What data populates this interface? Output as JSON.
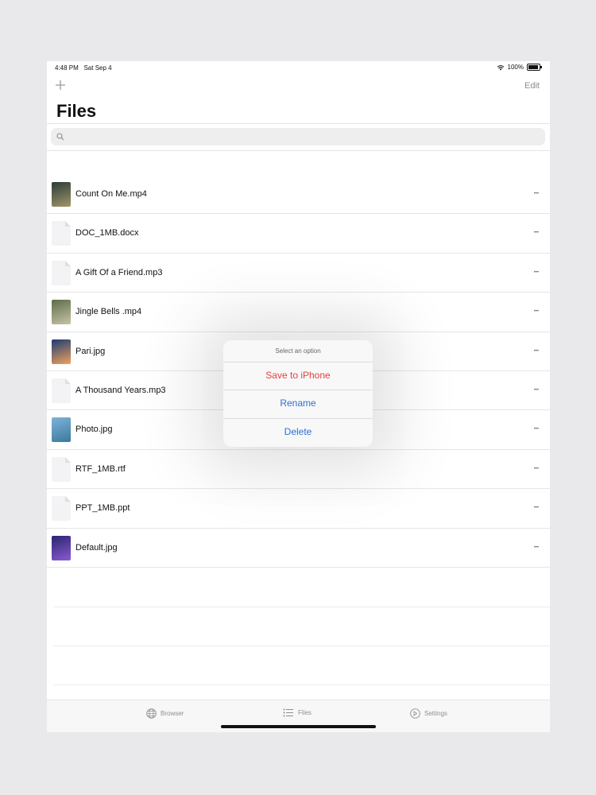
{
  "status_bar": {
    "time": "4:48 PM",
    "date": "Sat Sep 4",
    "battery": "100%"
  },
  "nav": {
    "add_icon": "plus-icon",
    "edit_label": "Edit",
    "title": "Files"
  },
  "search": {
    "placeholder": ""
  },
  "files": [
    {
      "name": "Count On Me.mp4",
      "kind": "image",
      "thumb_colors": [
        "#2b3a38",
        "#a3966a"
      ]
    },
    {
      "name": "DOC_1MB.docx",
      "kind": "doc"
    },
    {
      "name": "A Gift Of a Friend.mp3",
      "kind": "doc"
    },
    {
      "name": "Jingle Bells .mp4",
      "kind": "image",
      "thumb_colors": [
        "#5c6d4a",
        "#c8c3a6"
      ]
    },
    {
      "name": "Pari.jpg",
      "kind": "image",
      "thumb_colors": [
        "#1d3b75",
        "#f0a25a"
      ]
    },
    {
      "name": "A Thousand Years.mp3",
      "kind": "doc"
    },
    {
      "name": "Photo.jpg",
      "kind": "image",
      "thumb_colors": [
        "#7fb2d9",
        "#3a7a9c"
      ]
    },
    {
      "name": "RTF_1MB.rtf",
      "kind": "doc"
    },
    {
      "name": "PPT_1MB.ppt",
      "kind": "doc"
    },
    {
      "name": "Default.jpg",
      "kind": "image",
      "thumb_colors": [
        "#2b2470",
        "#8a5bd0"
      ]
    }
  ],
  "popup": {
    "heading": "Select an option",
    "options": [
      {
        "label": "Save to iPhone",
        "color": "#e5403d"
      },
      {
        "label": "Rename",
        "color": "#2e6fcf"
      },
      {
        "label": "Delete",
        "color": "#2e6fcf"
      }
    ]
  },
  "tabbar": {
    "items": [
      {
        "label": "Browser",
        "icon": "globe-icon"
      },
      {
        "label": "Files",
        "icon": "list-icon"
      },
      {
        "label": "Settings",
        "icon": "settings-icon"
      }
    ]
  }
}
